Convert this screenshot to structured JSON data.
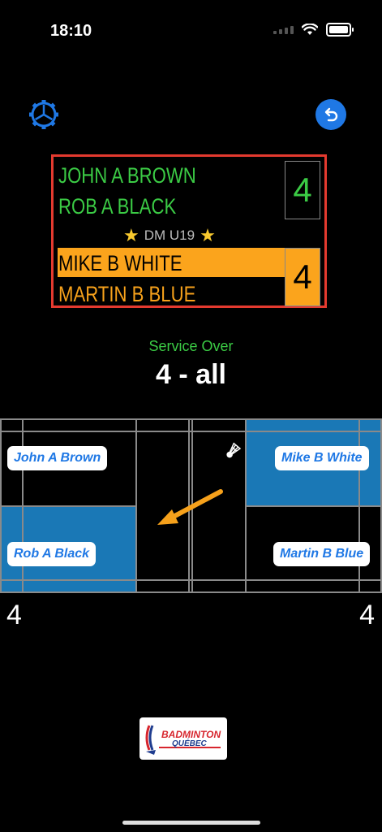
{
  "status_bar": {
    "time": "18:10"
  },
  "scoreboard": {
    "team1": {
      "players": [
        "JOHN A BROWN",
        "ROB A BLACK"
      ],
      "score": "4",
      "color": "#3bcb45"
    },
    "team2": {
      "players": [
        "MIKE B WHITE",
        "MARTIN B BLUE"
      ],
      "score": "4",
      "color": "#f6a11b"
    },
    "category": "DM U19",
    "border_color": "#e43a2f"
  },
  "call": {
    "status": "Service Over",
    "score_text": "4  - all"
  },
  "court": {
    "left_players": {
      "top": "John A Brown",
      "bottom": "Rob A Black"
    },
    "right_players": {
      "top": "Mike B White",
      "bottom": "Martin B Blue"
    },
    "left_score": "4",
    "right_score": "4",
    "highlight_color": "#1a78b6"
  },
  "logo": {
    "line1": "BADMINTON",
    "line2": "QUÉBEC"
  },
  "icons": {
    "settings": "gear-icon",
    "undo": "undo-icon",
    "shuttle": "shuttlecock-icon"
  }
}
